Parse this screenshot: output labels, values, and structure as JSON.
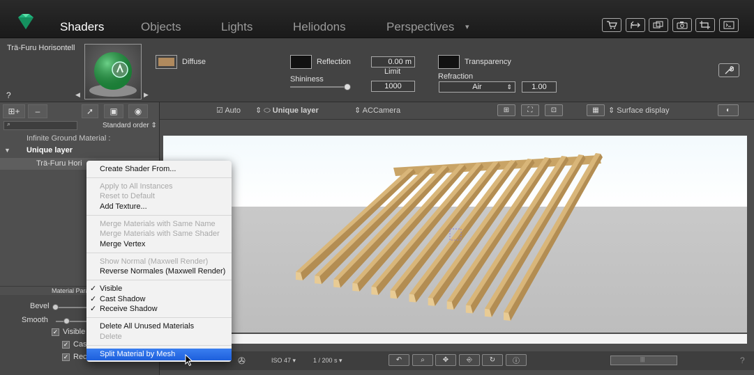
{
  "header": {
    "tabs": [
      {
        "label": "Shaders",
        "active": true
      },
      {
        "label": "Objects",
        "active": false
      },
      {
        "label": "Lights",
        "active": false
      },
      {
        "label": "Heliodons",
        "active": false
      },
      {
        "label": "Perspectives",
        "active": false
      }
    ],
    "perspectives_menu_glyph": "▾",
    "toolbar_icons": [
      "cart-icon",
      "export-icon",
      "windows-icon",
      "camera-icon",
      "crop-icon",
      "console-icon"
    ]
  },
  "material": {
    "name": "Trä-Furu Horisontell",
    "help": "?",
    "diffuse_label": "Diffuse",
    "diffuse_color": "#b08a5e",
    "reflection_label": "Reflection",
    "reflection_value": "0.00 m",
    "limit_label": "Limit",
    "limit_value": "1000",
    "shininess_label": "Shininess",
    "shininess_level": 0.95,
    "transparency_label": "Transparency",
    "refraction_label": "Refraction",
    "refraction_select": "Air",
    "refraction_value": "1.00"
  },
  "left_panel": {
    "sort_label": "Standard order",
    "tree": [
      {
        "label": "Infinite Ground Material :"
      },
      {
        "label": "Unique layer"
      },
      {
        "label": "Trä-Furu Hori"
      }
    ],
    "material_params_label": "Material Para",
    "bevel_label": "Bevel",
    "smooth_label": "Smooth",
    "visible_label": "Visible",
    "cast_label": "Cast",
    "receive_label": "Rece"
  },
  "viewport_toolbar": {
    "auto_label": "Auto",
    "layer_label": "Unique layer",
    "camera_label": "ACCamera",
    "display_label": "Surface display"
  },
  "bottom_bar": {
    "iso": "ISO 47",
    "shutter": "1 / 200 s",
    "help": "?"
  },
  "context_menu": {
    "items": [
      {
        "label": "Create Shader From...",
        "disabled": false,
        "checked": false
      },
      {
        "label": "Apply to All Instances",
        "disabled": true,
        "checked": false
      },
      {
        "label": "Reset to Default",
        "disabled": true,
        "checked": false
      },
      {
        "label": "Add Texture...",
        "disabled": false,
        "checked": false
      },
      {
        "label": "Merge Materials with Same Name",
        "disabled": true,
        "checked": false
      },
      {
        "label": "Merge Materials with Same Shader",
        "disabled": true,
        "checked": false
      },
      {
        "label": "Merge Vertex",
        "disabled": false,
        "checked": false
      },
      {
        "label": "Show Normal (Maxwell Render)",
        "disabled": true,
        "checked": false
      },
      {
        "label": "Reverse Normales (Maxwell Render)",
        "disabled": false,
        "checked": false
      },
      {
        "label": "Visible",
        "disabled": false,
        "checked": true
      },
      {
        "label": "Cast Shadow",
        "disabled": false,
        "checked": true
      },
      {
        "label": "Receive Shadow",
        "disabled": false,
        "checked": true
      },
      {
        "label": "Delete All Unused Materials",
        "disabled": false,
        "checked": false
      },
      {
        "label": "Delete",
        "disabled": true,
        "checked": false
      },
      {
        "label": "Split Material by Mesh",
        "disabled": false,
        "checked": false,
        "highlighted": true
      }
    ],
    "check_glyph": "✓"
  },
  "colors": {
    "wood": "#d9b679",
    "highlight": "#2a6ae6",
    "app_logo": "#21b57f"
  }
}
